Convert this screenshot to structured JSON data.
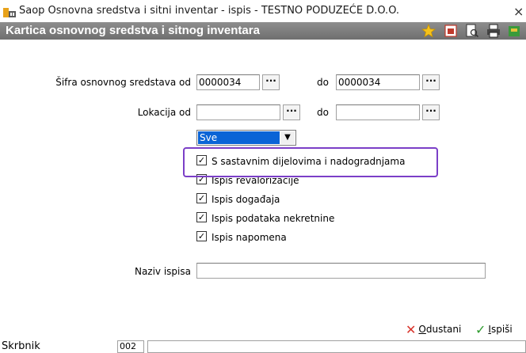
{
  "window": {
    "title": "Saop Osnovna sredstva i sitni inventar - ispis - TESTNO PODUZEĆE D.O.O.",
    "close": "×"
  },
  "header": {
    "title": "Kartica osnovnog sredstva i sitnog inventara",
    "icons": [
      "star-icon",
      "pdf-icon",
      "print-preview-icon",
      "printer-icon",
      "export-icon"
    ]
  },
  "form": {
    "sifra_label": "Šifra osnovnog sredstava od",
    "sifra_from": "0000034",
    "do_label": "do",
    "sifra_to": "0000034",
    "lokacija_label": "Lokacija od",
    "lokacija_from": "",
    "lokacija_to": "",
    "dots": "···",
    "select_value": "Sve",
    "checkboxes": [
      {
        "label": "S sastavnim dijelovima i nadogradnjama",
        "checked": true
      },
      {
        "label": "Ispis revalorizacije",
        "checked": true
      },
      {
        "label": "Ispis događaja",
        "checked": true
      },
      {
        "label": "Ispis podataka nekretnine",
        "checked": true
      },
      {
        "label": "Ispis napomena",
        "checked": true
      }
    ],
    "naziv_label": "Naziv ispisa",
    "naziv_value": ""
  },
  "buttons": {
    "cancel_prefix": "O",
    "cancel_rest": "dustani",
    "print_prefix": "I",
    "print_rest": "spiši"
  },
  "status": {
    "label": "Skrbnik",
    "code": "002",
    "value": ""
  },
  "colors": {
    "header_bg": "#7d7d7d",
    "select_highlight": "#0a64d6",
    "annotation_border": "#7b3fc7",
    "cancel_icon": "#d9342b",
    "print_icon": "#2e9b2e"
  }
}
